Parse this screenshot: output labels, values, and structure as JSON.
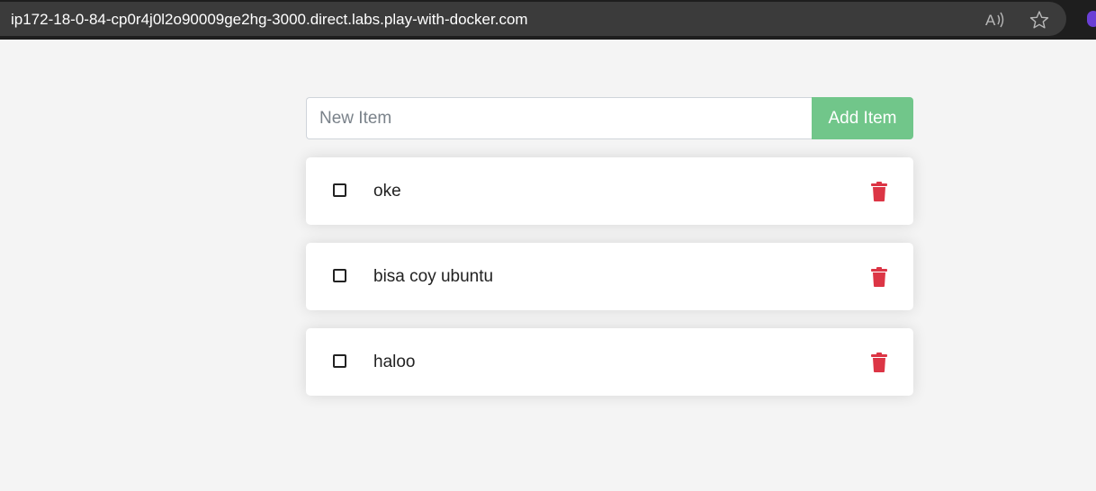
{
  "browser": {
    "url": "ip172-18-0-84-cp0r4j0l2o90009ge2hg-3000.direct.labs.play-with-docker.com",
    "icons": [
      "read-aloud-icon",
      "favorite-star-icon"
    ]
  },
  "form": {
    "placeholder": "New Item",
    "value": "",
    "add_label": "Add Item",
    "add_color": "#71c68a"
  },
  "items": [
    {
      "label": "oke",
      "completed": false
    },
    {
      "label": "bisa coy ubuntu",
      "completed": false
    },
    {
      "label": "haloo",
      "completed": false
    }
  ],
  "colors": {
    "delete": "#dc3545",
    "background": "#f4f4f4"
  }
}
